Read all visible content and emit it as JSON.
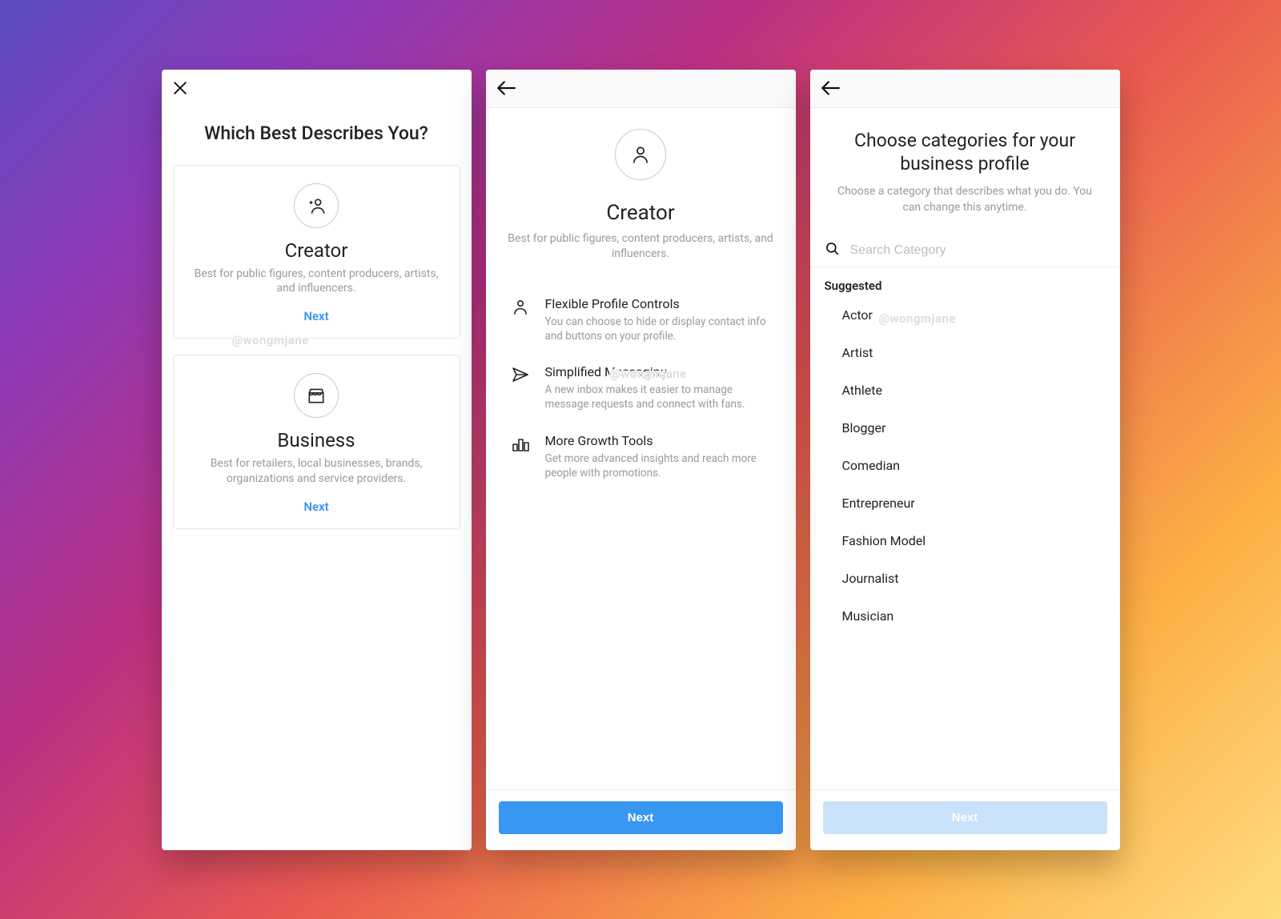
{
  "watermark": "@wongmjane",
  "screen1": {
    "title": "Which Best Describes You?",
    "creator": {
      "title": "Creator",
      "desc": "Best for public figures, content producers, artists, and influencers.",
      "next": "Next"
    },
    "business": {
      "title": "Business",
      "desc": "Best for retailers, local businesses, brands, organizations and service providers.",
      "next": "Next"
    }
  },
  "screen2": {
    "heading": "Creator",
    "sub": "Best for public figures, content producers, artists, and influencers.",
    "features": [
      {
        "title": "Flexible Profile Controls",
        "desc": "You can choose to hide or display contact info and buttons on your profile."
      },
      {
        "title": "Simplified Messaging",
        "desc": "A new inbox makes it easier to manage message requests and connect with fans."
      },
      {
        "title": "More Growth Tools",
        "desc": "Get more advanced insights and reach more people with promotions."
      }
    ],
    "next": "Next"
  },
  "screen3": {
    "title": "Choose categories for your business profile",
    "sub": "Choose a category that describes what you do. You can change this anytime.",
    "search_placeholder": "Search Category",
    "suggested_label": "Suggested",
    "categories": [
      "Actor",
      "Artist",
      "Athlete",
      "Blogger",
      "Comedian",
      "Entrepreneur",
      "Fashion Model",
      "Journalist",
      "Musician"
    ],
    "next": "Next"
  }
}
